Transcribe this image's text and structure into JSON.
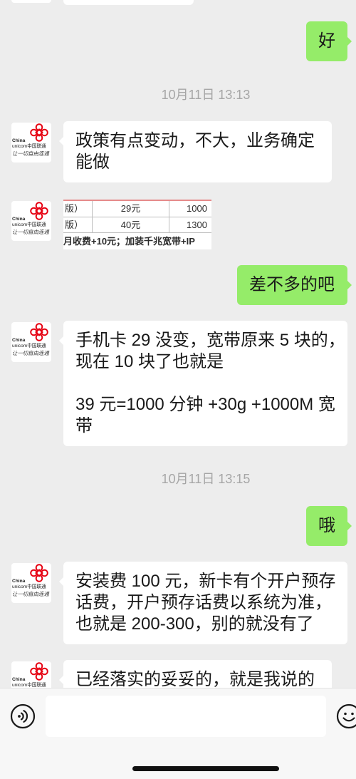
{
  "theme": {
    "background": "#ededed",
    "incoming_bubble": "#ffffff",
    "outgoing_bubble": "#95ec69",
    "timestamp": "#a6a6a6",
    "text": "#191919",
    "input_bar": "#f7f7f7",
    "logo_red": "#e60012"
  },
  "contact": {
    "avatar_logo": [
      "China",
      "unicom中国联通",
      "让一切自由连通"
    ]
  },
  "messages": [
    {
      "sent": [
        "好"
      ]
    },
    {
      "time": "10月11日 13:13"
    },
    {
      "received": [
        "政策有点变动，不大，业务确定",
        "能做"
      ]
    },
    {
      "received_image": {
        "rows": [
          [
            "版）",
            "29元",
            "1000"
          ],
          [
            "版）",
            "40元",
            "1300"
          ]
        ],
        "note": "月收费+10元；加装千兆宽带+IP"
      }
    },
    {
      "sent": [
        "差不多的吧"
      ]
    },
    {
      "received": [
        "手机卡 29 没变，宽带原来 5 块的，",
        "现在 10 块了也就是",
        "39 元=1000 分钟 +30g +1000M 宽",
        "带"
      ]
    },
    {
      "time": "10月11日 13:15"
    },
    {
      "sent": [
        "哦"
      ]
    },
    {
      "received": [
        "安装费 100 元，新卡有个开户预存",
        "话费，开户预存话费以系统为准，",
        "也就是 200-300，别的就没有了"
      ]
    },
    {
      "received": [
        "已经落实的妥妥的，就是我说的"
      ]
    }
  ],
  "input_bar": {
    "voice_icon": "voice-icon",
    "emoji_icon": "emoji-icon"
  }
}
